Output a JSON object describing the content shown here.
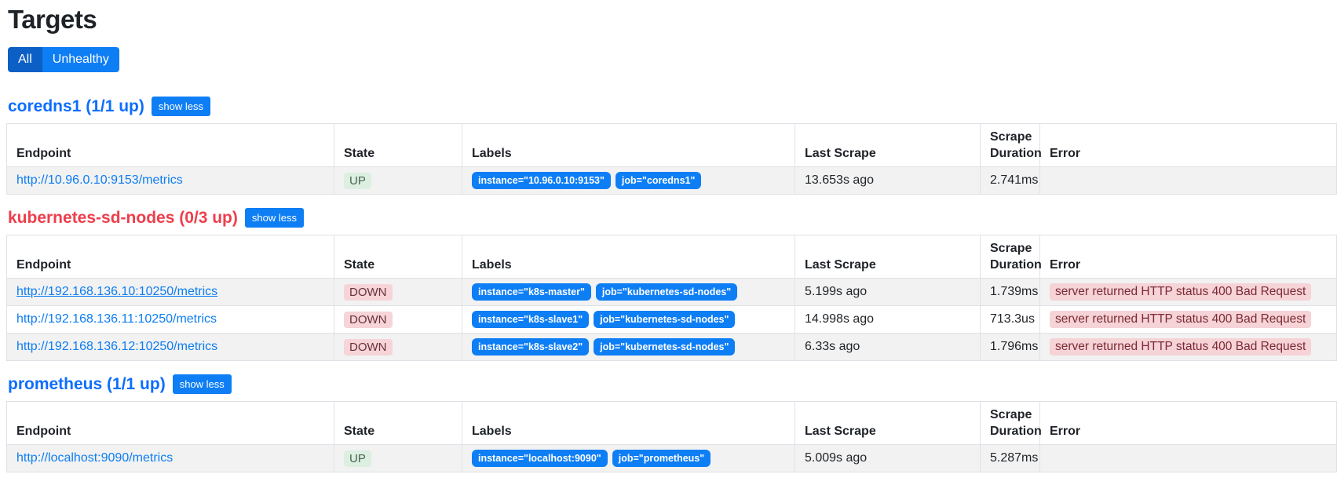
{
  "page": {
    "title": "Targets"
  },
  "filters": {
    "all_label": "All",
    "unhealthy_label": "Unhealthy"
  },
  "columns": [
    "Endpoint",
    "State",
    "Labels",
    "Last Scrape",
    "Scrape Duration",
    "Error"
  ],
  "colors": {
    "primary_blue": "#0e7ef5",
    "active_blue": "#0b5fc5",
    "healthy_heading": "#0d6efd",
    "unhealthy_heading": "#ee3e4c",
    "up_badge_bg": "#dcefe0",
    "down_badge_bg": "#f6d4d8",
    "error_badge_bg": "#f5d3d7",
    "error_badge_text": "#7c2a34",
    "row_stripe": "#f2f2f2",
    "table_border": "#dee2e6"
  },
  "jobs": [
    {
      "heading": "coredns1 (1/1 up)",
      "healthy": true,
      "toggle_label": "show less",
      "targets": [
        {
          "endpoint": "http://10.96.0.10:9153/metrics",
          "endpoint_hovered": false,
          "state": "UP",
          "labels": [
            "instance=\"10.96.0.10:9153\"",
            "job=\"coredns1\""
          ],
          "last_scrape": "13.653s ago",
          "scrape_duration": "2.741ms",
          "error": ""
        }
      ]
    },
    {
      "heading": "kubernetes-sd-nodes (0/3 up)",
      "healthy": false,
      "toggle_label": "show less",
      "targets": [
        {
          "endpoint": "http://192.168.136.10:10250/metrics",
          "endpoint_hovered": true,
          "state": "DOWN",
          "labels": [
            "instance=\"k8s-master\"",
            "job=\"kubernetes-sd-nodes\""
          ],
          "last_scrape": "5.199s ago",
          "scrape_duration": "1.739ms",
          "error": "server returned HTTP status 400 Bad Request"
        },
        {
          "endpoint": "http://192.168.136.11:10250/metrics",
          "endpoint_hovered": false,
          "state": "DOWN",
          "labels": [
            "instance=\"k8s-slave1\"",
            "job=\"kubernetes-sd-nodes\""
          ],
          "last_scrape": "14.998s ago",
          "scrape_duration": "713.3us",
          "error": "server returned HTTP status 400 Bad Request"
        },
        {
          "endpoint": "http://192.168.136.12:10250/metrics",
          "endpoint_hovered": false,
          "state": "DOWN",
          "labels": [
            "instance=\"k8s-slave2\"",
            "job=\"kubernetes-sd-nodes\""
          ],
          "last_scrape": "6.33s ago",
          "scrape_duration": "1.796ms",
          "error": "server returned HTTP status 400 Bad Request"
        }
      ]
    },
    {
      "heading": "prometheus (1/1 up)",
      "healthy": true,
      "toggle_label": "show less",
      "targets": [
        {
          "endpoint": "http://localhost:9090/metrics",
          "endpoint_hovered": false,
          "state": "UP",
          "labels": [
            "instance=\"localhost:9090\"",
            "job=\"prometheus\""
          ],
          "last_scrape": "5.009s ago",
          "scrape_duration": "5.287ms",
          "error": ""
        }
      ]
    }
  ]
}
